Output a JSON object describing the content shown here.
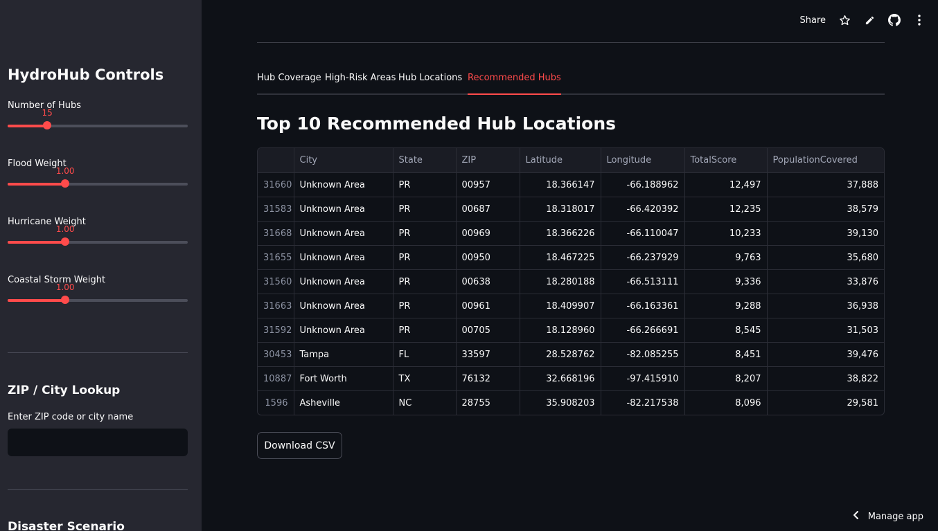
{
  "toolbar": {
    "share_label": "Share",
    "icons": [
      "star-icon",
      "pencil-icon",
      "github-icon",
      "more-vertical-icon"
    ]
  },
  "sidebar": {
    "title": "HydroHub Controls",
    "sliders": [
      {
        "label": "Number of Hubs",
        "value": "15",
        "fraction": 0.22
      },
      {
        "label": "Flood Weight",
        "value": "1.00",
        "fraction": 0.32
      },
      {
        "label": "Hurricane Weight",
        "value": "1.00",
        "fraction": 0.32
      },
      {
        "label": "Coastal Storm Weight",
        "value": "1.00",
        "fraction": 0.32
      }
    ],
    "lookup": {
      "heading": "ZIP / City Lookup",
      "label": "Enter ZIP code or city name",
      "value": "",
      "placeholder": ""
    },
    "scenario_heading": "Disaster Scenario"
  },
  "tabs": [
    {
      "label": "Hub Coverage"
    },
    {
      "label": "High-Risk Areas"
    },
    {
      "label": "Hub Locations"
    },
    {
      "label": "Recommended Hubs",
      "active": true
    }
  ],
  "main": {
    "title": "Top 10 Recommended Hub Locations",
    "table": {
      "columns": [
        "",
        "City",
        "State",
        "ZIP",
        "Latitude",
        "Longitude",
        "TotalScore",
        "PopulationCovered"
      ],
      "rows": [
        [
          "31660",
          "Unknown Area",
          "PR",
          "00957",
          "18.366147",
          "-66.188962",
          "12,497",
          "37,888"
        ],
        [
          "31583",
          "Unknown Area",
          "PR",
          "00687",
          "18.318017",
          "-66.420392",
          "12,235",
          "38,579"
        ],
        [
          "31668",
          "Unknown Area",
          "PR",
          "00969",
          "18.366226",
          "-66.110047",
          "10,233",
          "39,130"
        ],
        [
          "31655",
          "Unknown Area",
          "PR",
          "00950",
          "18.467225",
          "-66.237929",
          "9,763",
          "35,680"
        ],
        [
          "31560",
          "Unknown Area",
          "PR",
          "00638",
          "18.280188",
          "-66.513111",
          "9,336",
          "33,876"
        ],
        [
          "31663",
          "Unknown Area",
          "PR",
          "00961",
          "18.409907",
          "-66.163361",
          "9,288",
          "36,938"
        ],
        [
          "31592",
          "Unknown Area",
          "PR",
          "00705",
          "18.128960",
          "-66.266691",
          "8,545",
          "31,503"
        ],
        [
          "30453",
          "Tampa",
          "FL",
          "33597",
          "28.528762",
          "-82.085255",
          "8,451",
          "39,476"
        ],
        [
          "10887",
          "Fort Worth",
          "TX",
          "76132",
          "32.668196",
          "-97.415910",
          "8,207",
          "38,822"
        ],
        [
          "1596",
          "Asheville",
          "NC",
          "28755",
          "35.908203",
          "-82.217538",
          "8,096",
          "29,581"
        ]
      ]
    },
    "download_label": "Download CSV"
  },
  "footer": {
    "manage_label": "Manage app"
  },
  "colors": {
    "accent": "#ff4b4b",
    "sidebar_bg": "#262730",
    "main_bg": "#0e1117"
  }
}
